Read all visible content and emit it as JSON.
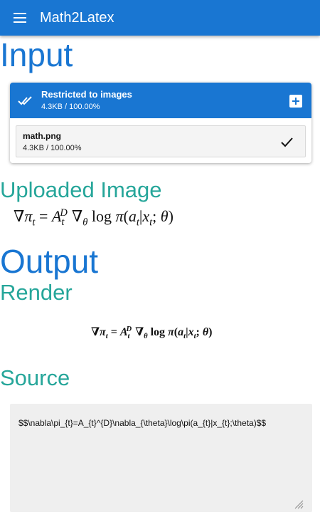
{
  "app": {
    "title": "Math2Latex"
  },
  "input": {
    "heading": "Input",
    "uploader": {
      "restriction_label": "Restricted to images",
      "total_progress": "4.3KB / 100.00%",
      "file": {
        "name": "math.png",
        "progress": "4.3KB / 100.00%"
      }
    }
  },
  "uploaded": {
    "heading": "Uploaded Image"
  },
  "output": {
    "heading": "Output",
    "render": {
      "heading": "Render"
    },
    "source": {
      "heading": "Source",
      "latex": "$$\\nabla\\pi_{t}=A_{t}^{D}\\nabla_{\\theta}\\log\\pi(a_{t}|x_{t};\\theta)$$"
    }
  },
  "icons": {
    "menu": "menu-icon",
    "done_all": "done-all-icon",
    "add": "add-box-icon",
    "check": "check-icon",
    "resize": "resize-grip-icon"
  },
  "colors": {
    "primary": "#1976d2",
    "accent": "#26a69a",
    "source_bg": "#efefef"
  }
}
